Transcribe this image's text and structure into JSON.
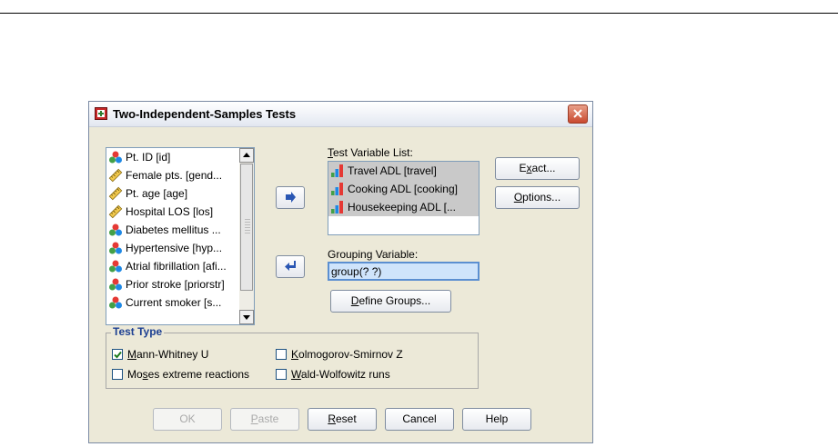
{
  "dialog": {
    "title": "Two-Independent-Samples Tests"
  },
  "variable_list": [
    {
      "label": "Pt. ID [id]",
      "icon": "nominal-icon"
    },
    {
      "label": "Female pts. [gend...",
      "icon": "scale-icon"
    },
    {
      "label": "Pt. age [age]",
      "icon": "scale-icon"
    },
    {
      "label": "Hospital LOS [los]",
      "icon": "scale-icon"
    },
    {
      "label": "Diabetes mellitus ...",
      "icon": "nominal-icon"
    },
    {
      "label": "Hypertensive [hyp...",
      "icon": "nominal-icon"
    },
    {
      "label": "Atrial fibrillation [afi...",
      "icon": "nominal-icon"
    },
    {
      "label": "Prior stroke [priorstr]",
      "icon": "nominal-icon"
    },
    {
      "label": "Current smoker [s...",
      "icon": "nominal-icon"
    }
  ],
  "test_variable": {
    "label_prefix": "",
    "label_mnemonic": "T",
    "label_rest": "est Variable List:",
    "items": [
      {
        "label": "Travel ADL [travel]"
      },
      {
        "label": "Cooking ADL [cooking]"
      },
      {
        "label": "Housekeeping ADL [..."
      }
    ]
  },
  "grouping": {
    "label": "Grouping Variable:",
    "value": "group(? ?)",
    "define_prefix": "",
    "define_mnemonic": "D",
    "define_rest": "efine Groups..."
  },
  "side_buttons": {
    "exact": {
      "pre": "E",
      "mn": "x",
      "post": "act..."
    },
    "options": {
      "pre": "",
      "mn": "O",
      "post": "ptions..."
    }
  },
  "test_type": {
    "legend": "Test Type",
    "options": [
      {
        "pre": "",
        "mn": "M",
        "post": "ann-Whitney U",
        "checked": true
      },
      {
        "pre": "",
        "mn": "K",
        "post": "olmogorov-Smirnov Z",
        "checked": false
      },
      {
        "pre": "Mo",
        "mn": "s",
        "post": "es extreme reactions",
        "checked": false
      },
      {
        "pre": "",
        "mn": "W",
        "post": "ald-Wolfowitz runs",
        "checked": false
      }
    ]
  },
  "bottom_buttons": {
    "ok": "OK",
    "paste": {
      "pre": "",
      "mn": "P",
      "post": "aste"
    },
    "reset": {
      "pre": "",
      "mn": "R",
      "post": "eset"
    },
    "cancel": "Cancel",
    "help": "Help"
  }
}
